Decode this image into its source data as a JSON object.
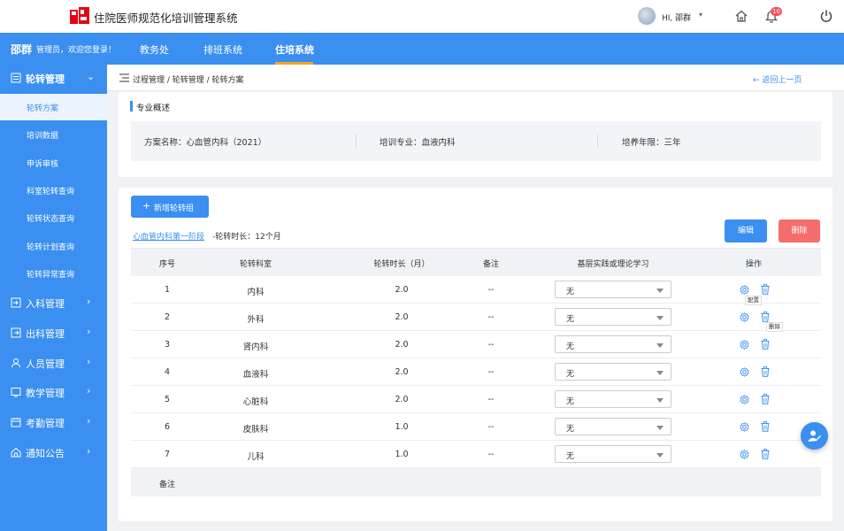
{
  "app": {
    "title": "住院医师规范化培训管理系统"
  },
  "topbar": {
    "greeting": "HI, 邵群",
    "notification_count": "10"
  },
  "header": {
    "user_name": "邵群",
    "user_sub": "管理员，欢迎您登录！",
    "tabs": [
      {
        "label": "教务处"
      },
      {
        "label": "排班系统"
      },
      {
        "label": "住培系统"
      }
    ],
    "active_tab": "住培系统"
  },
  "sidebar": {
    "groups": [
      {
        "label": "轮转管理",
        "icon": "rotation-icon",
        "expanded": true
      },
      {
        "label": "入科管理",
        "icon": "enter-icon"
      },
      {
        "label": "出科管理",
        "icon": "exit-icon"
      },
      {
        "label": "人员管理",
        "icon": "person-icon"
      },
      {
        "label": "教学管理",
        "icon": "teaching-icon"
      },
      {
        "label": "考勤管理",
        "icon": "calendar-icon"
      },
      {
        "label": "通知公告",
        "icon": "notice-icon"
      }
    ],
    "sub_items": [
      {
        "label": "轮转方案",
        "active": true
      },
      {
        "label": "培训数据"
      },
      {
        "label": "申诉审核"
      },
      {
        "label": "科室轮转查询"
      },
      {
        "label": "轮转状态查询"
      },
      {
        "label": "轮转计划查询"
      },
      {
        "label": "轮转异常查询"
      }
    ]
  },
  "breadcrumb": {
    "path": "过程管理 / 轮转管理 / 轮转方案",
    "back": "← 返回上一页"
  },
  "overview": {
    "title": "专业概述",
    "plan_name": "方案名称：心血管内科（2021）",
    "major": "培训专业：血液内科",
    "years": "培养年限：三年"
  },
  "rotation": {
    "add_button": "新增轮转组",
    "phase_name": "心血管内科第一阶段",
    "phase_duration": "-轮转时长：12个月",
    "edit_button": "编辑",
    "delete_button": "删除",
    "columns": [
      "序号",
      "轮转科室",
      "轮转时长（月）",
      "备注",
      "基层实践或理论学习",
      "操作"
    ],
    "rows": [
      {
        "no": "1",
        "dept": "内科",
        "duration": "2.0",
        "remark": "--",
        "select": "无"
      },
      {
        "no": "2",
        "dept": "外科",
        "duration": "2.0",
        "remark": "--",
        "select": "无"
      },
      {
        "no": "3",
        "dept": "肾内科",
        "duration": "2.0",
        "remark": "--",
        "select": "无"
      },
      {
        "no": "4",
        "dept": "血液科",
        "duration": "2.0",
        "remark": "--",
        "select": "无"
      },
      {
        "no": "5",
        "dept": "心脏科",
        "duration": "2.0",
        "remark": "--",
        "select": "无"
      },
      {
        "no": "6",
        "dept": "皮肤科",
        "duration": "1.0",
        "remark": "--",
        "select": "无"
      },
      {
        "no": "7",
        "dept": "儿科",
        "duration": "1.0",
        "remark": "--",
        "select": "无"
      }
    ],
    "tooltip_config": "配置",
    "tooltip_delete": "删除",
    "footer_label": "备注"
  },
  "colors": {
    "primary": "#3a8ff0",
    "danger": "#f56c6c",
    "accent": "#f5a623"
  }
}
